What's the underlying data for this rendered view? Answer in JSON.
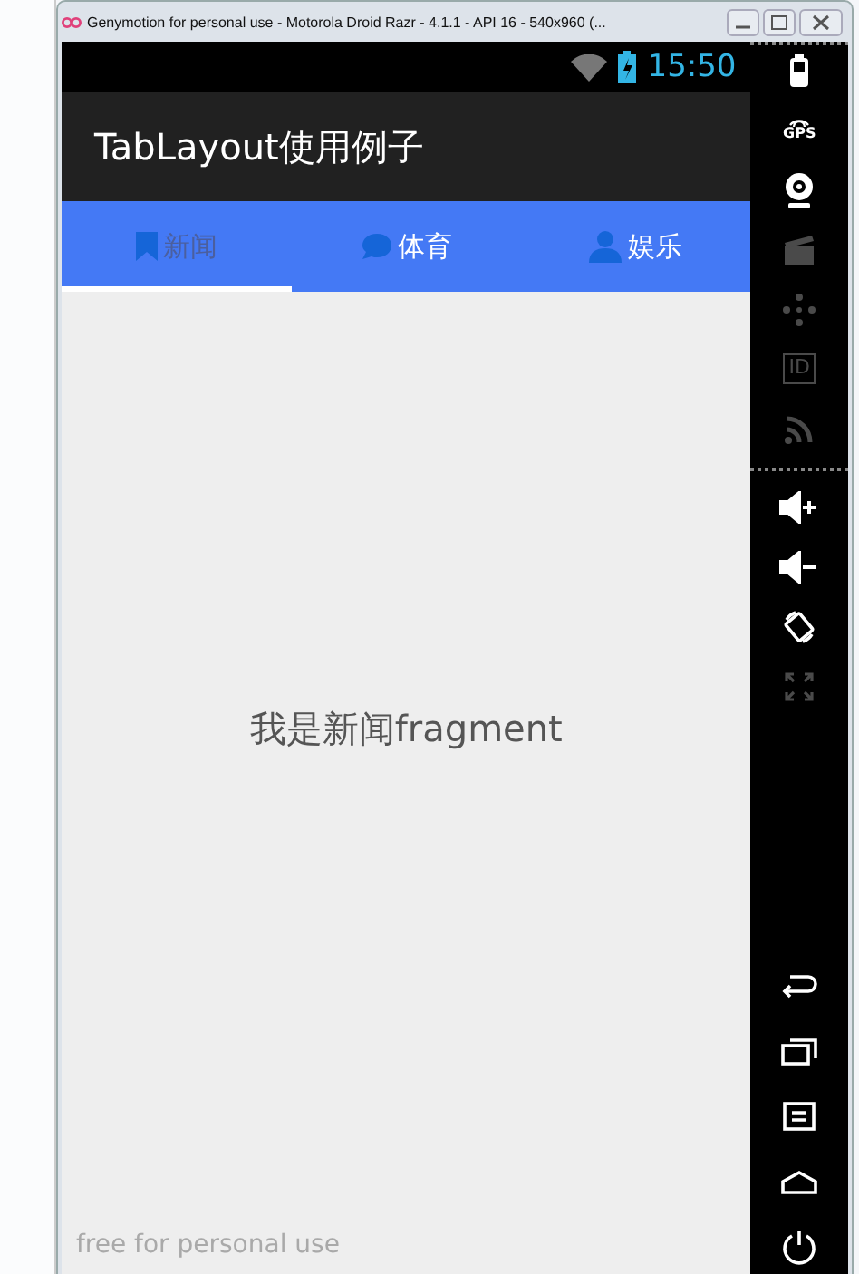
{
  "window": {
    "title": "Genymotion for personal use - Motorola Droid Razr - 4.1.1 - API 16 - 540x960 (..."
  },
  "status_bar": {
    "time": "15:50"
  },
  "app_bar": {
    "title": "TabLayout使用例子"
  },
  "tabs": [
    {
      "label": "新闻",
      "selected": true
    },
    {
      "label": "体育",
      "selected": false
    },
    {
      "label": "娱乐",
      "selected": false
    }
  ],
  "content": {
    "text": "我是新闻fragment"
  },
  "overlay": {
    "text": "free for personal use"
  },
  "sidebar": {
    "top": [
      {
        "disabled": false
      },
      {
        "label": "GPS",
        "disabled": false
      },
      {
        "disabled": false
      },
      {
        "disabled": true
      },
      {
        "disabled": true
      },
      {
        "label": "ID",
        "disabled": true
      },
      {
        "disabled": true
      }
    ],
    "middle": [
      {
        "disabled": false
      },
      {
        "disabled": false
      },
      {
        "disabled": false
      },
      {
        "disabled": true
      }
    ],
    "bottom": [
      {
        "disabled": false
      },
      {
        "disabled": false
      },
      {
        "disabled": false
      },
      {
        "disabled": false
      },
      {
        "disabled": false
      }
    ]
  }
}
